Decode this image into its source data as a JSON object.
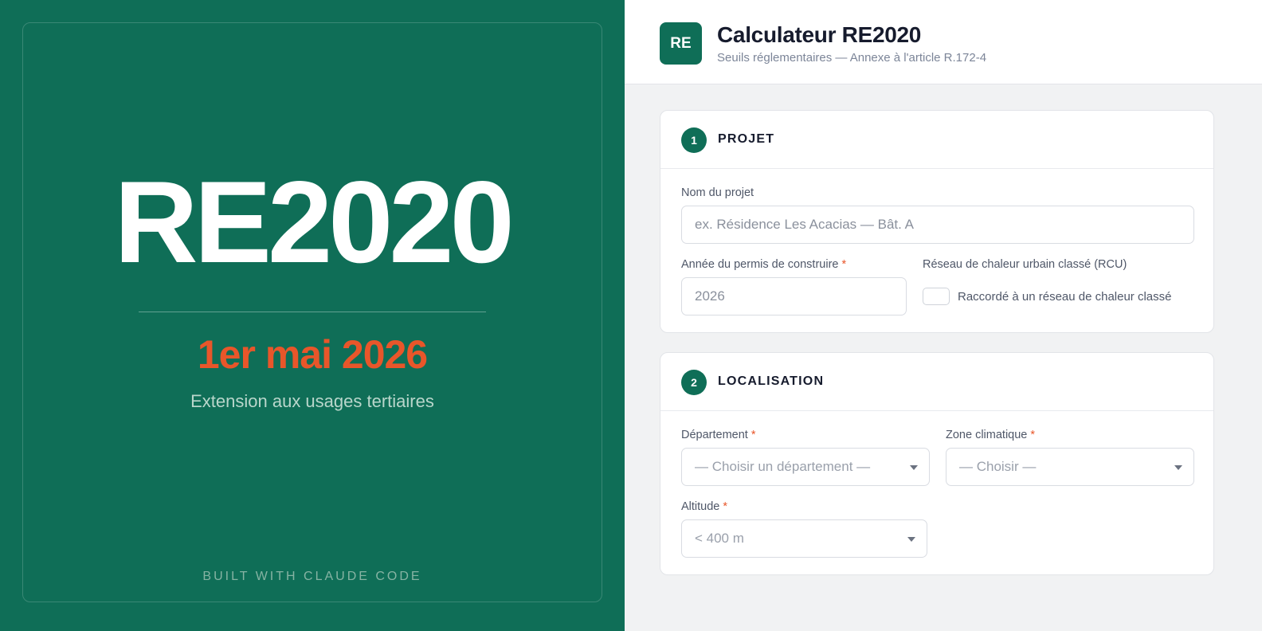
{
  "hero": {
    "title": "RE2020",
    "date": "1er mai 2026",
    "subtitle": "Extension aux usages tertiaires",
    "footer": "BUILT WITH CLAUDE CODE"
  },
  "header": {
    "logo": "RE",
    "title": "Calculateur RE2020",
    "subtitle": "Seuils réglementaires — Annexe à l'article R.172-4"
  },
  "projet": {
    "step": "1",
    "title": "PROJET",
    "nom_label": "Nom du projet",
    "nom_placeholder": "ex. Résidence Les Acacias — Bât. A",
    "annee_label": "Année du permis de construire",
    "annee_placeholder": "2026",
    "rcu_label": "Réseau de chaleur urbain classé (RCU)",
    "rcu_checkbox_label": "Raccordé à un réseau de chaleur classé",
    "required_mark": "*"
  },
  "localisation": {
    "step": "2",
    "title": "LOCALISATION",
    "departement_label": "Département",
    "departement_value": "— Choisir un département —",
    "zone_label": "Zone climatique",
    "zone_value": "— Choisir —",
    "altitude_label": "Altitude",
    "altitude_value": "< 400 m",
    "required_mark": "*"
  },
  "colors": {
    "brand_green": "#0f6e57",
    "accent_orange": "#e8562a"
  }
}
